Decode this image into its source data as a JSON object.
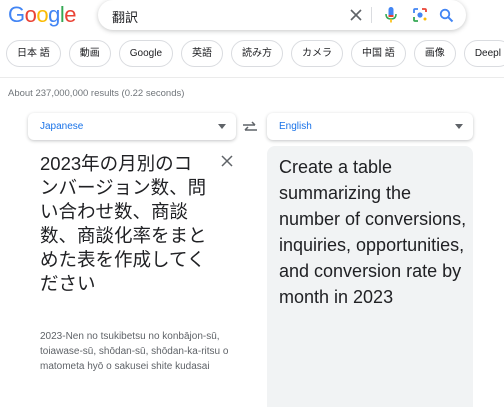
{
  "logo": {
    "text": "Google",
    "letters": [
      {
        "ch": "G",
        "color": "#4285F4"
      },
      {
        "ch": "o",
        "color": "#EA4335"
      },
      {
        "ch": "o",
        "color": "#FBBC05"
      },
      {
        "ch": "g",
        "color": "#4285F4"
      },
      {
        "ch": "l",
        "color": "#34A853"
      },
      {
        "ch": "e",
        "color": "#EA4335"
      }
    ]
  },
  "search": {
    "query": "翻訳",
    "icons": [
      "clear-icon",
      "microphone-icon",
      "lens-icon",
      "search-icon"
    ]
  },
  "chips": [
    {
      "label": "日本 語"
    },
    {
      "label": "動画"
    },
    {
      "label": "Google"
    },
    {
      "label": "英語"
    },
    {
      "label": "読み方"
    },
    {
      "label": "カメラ"
    },
    {
      "label": "中国 語"
    },
    {
      "label": "画像"
    },
    {
      "label": "Deepl"
    }
  ],
  "result_stats": "About 237,000,000 results (0.22 seconds)",
  "translator": {
    "source_lang": "Japanese",
    "target_lang": "English",
    "source_text": "2023年の月別のコンバージョン数、問い合わせ数、商談数、商談化率をまとめた表を作成してください",
    "romanization": "2023-Nen no tsukibetsu no konbājon-sū, toiawase-sū, shōdan-sū, shōdan-ka-ritsu o matometa hyō o sakusei shite kudasai",
    "target_text": "Create a table summarizing the number of conversions, inquiries, opportunities, and conversion rate by month in 2023"
  },
  "colors": {
    "accent": "#1a73e8",
    "panel_bg": "#f1f3f4",
    "muted": "#70757a"
  }
}
